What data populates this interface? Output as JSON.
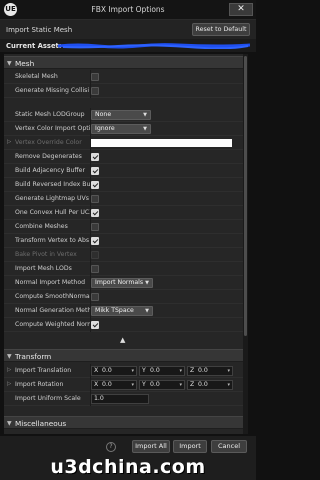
{
  "window": {
    "title": "FBX Import Options",
    "logo": "UE",
    "close_glyph": "✕"
  },
  "header": {
    "import_type": "Import Static Mesh",
    "reset_label": "Reset to Default",
    "current_asset_label": "Current Asset:"
  },
  "mesh": {
    "section_label": "Mesh",
    "rows": [
      {
        "label": "Skeletal Mesh",
        "checked": false
      },
      {
        "label": "Generate Missing Collisi",
        "checked": false
      },
      {
        "label": "Static Mesh LODGroup",
        "value": "None"
      },
      {
        "label": "Vertex Color Import Opti",
        "value": "Ignore"
      },
      {
        "label": "Vertex Override Color"
      },
      {
        "label": "Remove Degenerates",
        "checked": true
      },
      {
        "label": "Build Adjacency Buffer",
        "checked": true
      },
      {
        "label": "Build Reversed Index Buf",
        "checked": true
      },
      {
        "label": "Generate Lightmap UVs",
        "checked": false
      },
      {
        "label": "One Convex Hull Per UCX",
        "checked": true
      },
      {
        "label": "Combine Meshes",
        "checked": false
      },
      {
        "label": "Transform Vertex to Abs",
        "checked": true
      },
      {
        "label": "Bake Pivot in Vertex",
        "checked": false
      },
      {
        "label": "Import Mesh LODs",
        "checked": false
      },
      {
        "label": "Normal Import Method",
        "value": "Import Normals"
      },
      {
        "label": "Compute SmoothNormal",
        "checked": false
      },
      {
        "label": "Normal Generation Meth",
        "value": "Mikk TSpace"
      },
      {
        "label": "Compute Weighted Norm",
        "checked": true
      }
    ],
    "advanced_glyph": "▲"
  },
  "transform": {
    "section_label": "Transform",
    "translation": {
      "label": "Import Translation",
      "x": "0.0",
      "y": "0.0",
      "z": "0.0"
    },
    "rotation": {
      "label": "Import Rotation",
      "x": "0.0",
      "y": "0.0",
      "z": "0.0"
    },
    "scale": {
      "label": "Import Uniform Scale",
      "value": "1.0"
    },
    "axes": [
      "X",
      "Y",
      "Z"
    ]
  },
  "misc": {
    "section_label": "Miscellaneous"
  },
  "footer": {
    "help_glyph": "?",
    "import_all_label": "Import All",
    "import_label": "Import",
    "cancel_label": "Cancel",
    "watermark": "u3dchina.com"
  },
  "colors": {
    "panel": "#262626",
    "section": "#363636",
    "checkbox_on": "#dcdcdc",
    "asset_scribble": "#1f4ff0"
  }
}
